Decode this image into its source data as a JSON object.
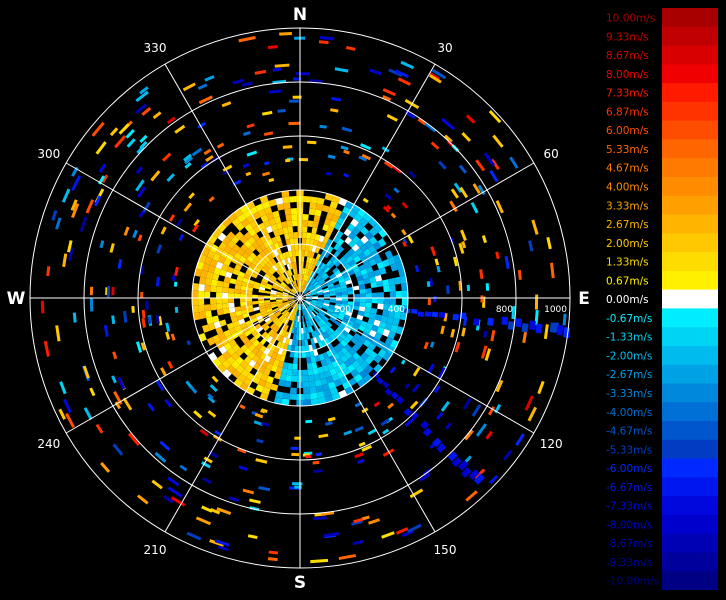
{
  "chart_data": {
    "type": "polar-radial-velocity",
    "cardinal_labels": {
      "N": "N",
      "E": "E",
      "S": "S",
      "W": "W"
    },
    "azimuth_labels": [
      {
        "deg": 30,
        "text": "30"
      },
      {
        "deg": 60,
        "text": "60"
      },
      {
        "deg": 120,
        "text": "120"
      },
      {
        "deg": 150,
        "text": "150"
      },
      {
        "deg": 210,
        "text": "210"
      },
      {
        "deg": 240,
        "text": "240"
      },
      {
        "deg": 300,
        "text": "300"
      },
      {
        "deg": 330,
        "text": "330"
      }
    ],
    "range_rings": [
      200,
      400,
      600,
      800,
      1000
    ],
    "range_labels": [
      {
        "value": 200,
        "text": "200"
      },
      {
        "value": 400,
        "text": "400"
      },
      {
        "value": 800,
        "text": "800"
      },
      {
        "value": 1000,
        "text": "1000"
      }
    ],
    "max_range": 1000,
    "color_scale": [
      {
        "value": 10.0,
        "text": "10.00m/s",
        "color": "#a80000"
      },
      {
        "value": 9.33,
        "text": "9.33m/s",
        "color": "#c00000"
      },
      {
        "value": 8.67,
        "text": "8.67m/s",
        "color": "#d80000"
      },
      {
        "value": 8.0,
        "text": "8.00m/s",
        "color": "#f00000"
      },
      {
        "value": 7.33,
        "text": "7.33m/s",
        "color": "#ff1a00"
      },
      {
        "value": 6.87,
        "text": "6.87m/s",
        "color": "#ff3300"
      },
      {
        "value": 6.0,
        "text": "6.00m/s",
        "color": "#ff4d00"
      },
      {
        "value": 5.33,
        "text": "5.33m/s",
        "color": "#ff6600"
      },
      {
        "value": 4.67,
        "text": "4.67m/s",
        "color": "#ff7a00"
      },
      {
        "value": 4.0,
        "text": "4.00m/s",
        "color": "#ff8c00"
      },
      {
        "value": 3.33,
        "text": "3.33m/s",
        "color": "#ffa000"
      },
      {
        "value": 2.67,
        "text": "2.67m/s",
        "color": "#ffb400"
      },
      {
        "value": 2.0,
        "text": "2.00m/s",
        "color": "#ffc800"
      },
      {
        "value": 1.33,
        "text": "1.33m/s",
        "color": "#ffdc00"
      },
      {
        "value": 0.67,
        "text": "0.67m/s",
        "color": "#fff000"
      },
      {
        "value": 0.0,
        "text": "0.00m/s",
        "color": "#ffffff"
      },
      {
        "value": -0.67,
        "text": "-0.67m/s",
        "color": "#00eeff"
      },
      {
        "value": -1.33,
        "text": "-1.33m/s",
        "color": "#00d4f4"
      },
      {
        "value": -2.0,
        "text": "-2.00m/s",
        "color": "#00bbee"
      },
      {
        "value": -2.67,
        "text": "-2.67m/s",
        "color": "#00a2e6"
      },
      {
        "value": -3.33,
        "text": "-3.33m/s",
        "color": "#0088dd"
      },
      {
        "value": -4.0,
        "text": "-4.00m/s",
        "color": "#006fd6"
      },
      {
        "value": -4.67,
        "text": "-4.67m/s",
        "color": "#0056cc"
      },
      {
        "value": -5.33,
        "text": "-5.33m/s",
        "color": "#003dc3"
      },
      {
        "value": -6.0,
        "text": "-6.00m/s",
        "color": "#0028ff"
      },
      {
        "value": -6.67,
        "text": "-6.67m/s",
        "color": "#0016ee"
      },
      {
        "value": -7.33,
        "text": "-7.33m/s",
        "color": "#0008dd"
      },
      {
        "value": -8.0,
        "text": "-8.00m/s",
        "color": "#0000cc"
      },
      {
        "value": -8.67,
        "text": "-8.67m/s",
        "color": "#0000b4"
      },
      {
        "value": -9.33,
        "text": "-9.33m/s",
        "color": "#00009c"
      },
      {
        "value": -10.0,
        "text": "-10.00m/s",
        "color": "#000084"
      }
    ],
    "grid": true,
    "legend_placement": "right"
  }
}
